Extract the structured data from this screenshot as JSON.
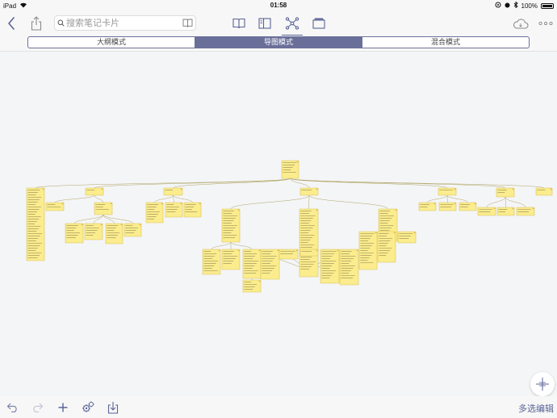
{
  "status_bar": {
    "device": "iPad",
    "time": "01:58",
    "battery": "100%"
  },
  "toolbar": {
    "search_placeholder": "搜索笔记卡片",
    "active_tab": "mindmap-tab"
  },
  "view_modes": {
    "items": [
      {
        "label": "大纲模式",
        "active": false
      },
      {
        "label": "导图模式",
        "active": true
      },
      {
        "label": "混合模式",
        "active": false
      }
    ]
  },
  "bottom_bar": {
    "multi_select_label": "多选编辑"
  },
  "colors": {
    "accent": "#5a6396",
    "segment_active": "#6a6f9a",
    "card_fill": "#fbec8d",
    "card_border": "#d9c25a",
    "connector": "#a79b55",
    "canvas": "#f4f5f7"
  }
}
